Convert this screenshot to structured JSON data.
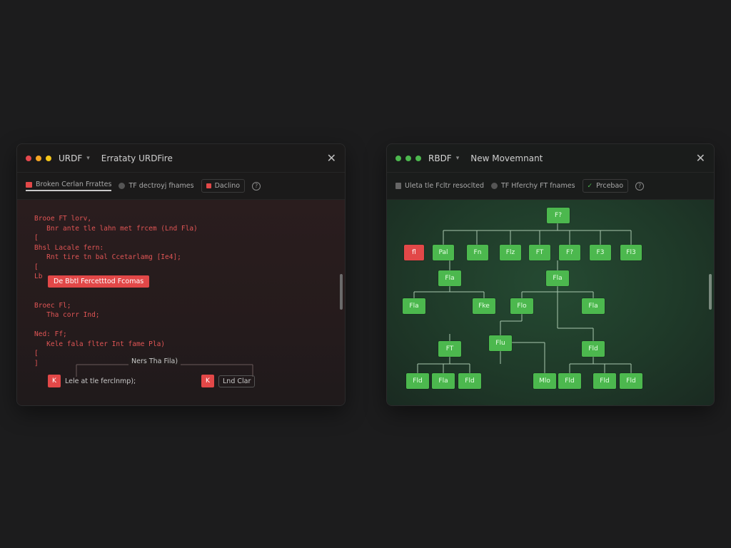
{
  "left_panel": {
    "app_name": "URDF",
    "doc_title": "Errataty URDFire",
    "dot_colors": [
      "#e5484d",
      "#f5a524",
      "#f5c518"
    ],
    "toolbar": {
      "item1": "Broken Cerlan Frrattes",
      "item2": "TF dectroyj fhames",
      "item3": "Daclino",
      "help": "?"
    },
    "code_lines": [
      "Brooe FT lorv,",
      "   Bnr ante tle lahn met frcem (Lnd Fla)",
      "[",
      "Bhsl Lacale fern:",
      "   Rnt tire tn bal Ccetarlamg [Ie4];",
      "[",
      "Lb",
      "",
      "",
      "Broec Fl;",
      "   Tha corr Ind;",
      "",
      "Ned: Ff;",
      "   Kele fala flter Int fame Pla)",
      "[",
      "]"
    ],
    "error_badge": "De Bbtl Fercetttod Fcomas",
    "bottom": {
      "center_label": "Ners Tha Fila)",
      "left_icon": "K",
      "left_label": "Lele at tle ferclnmp);",
      "right_icon": "K",
      "right_label": "Lnd Clar"
    }
  },
  "right_panel": {
    "app_name": "RBDF",
    "doc_title": "New Movemnant",
    "dot_colors": [
      "#4cb84e",
      "#4cb84e",
      "#4cb84e"
    ],
    "toolbar": {
      "item1": "Uleta tle Fcltr resoclted",
      "item2": "TF Hferchy FT fnames",
      "item3": "Prcebao",
      "help": "?"
    },
    "tree_nodes": [
      {
        "id": "root",
        "label": "F?",
        "color": "green"
      },
      {
        "id": "n1",
        "label": "fl",
        "color": "red"
      },
      {
        "id": "n2",
        "label": "Pal",
        "color": "green"
      },
      {
        "id": "n3",
        "label": "Fn",
        "color": "green"
      },
      {
        "id": "n4",
        "label": "Flz",
        "color": "green"
      },
      {
        "id": "n5",
        "label": "FT",
        "color": "green"
      },
      {
        "id": "n6",
        "label": "F?",
        "color": "green"
      },
      {
        "id": "n7",
        "label": "F3",
        "color": "green"
      },
      {
        "id": "n8",
        "label": "Fl3",
        "color": "green"
      },
      {
        "id": "m1",
        "label": "Fla",
        "color": "green"
      },
      {
        "id": "m2",
        "label": "Fla",
        "color": "green"
      },
      {
        "id": "l1",
        "label": "Fla",
        "color": "green"
      },
      {
        "id": "l2",
        "label": "Fke",
        "color": "green"
      },
      {
        "id": "l3",
        "label": "Flo",
        "color": "green"
      },
      {
        "id": "l4",
        "label": "Fla",
        "color": "green"
      },
      {
        "id": "k1",
        "label": "Flu",
        "color": "green"
      },
      {
        "id": "k2",
        "label": "FT",
        "color": "green"
      },
      {
        "id": "k3",
        "label": "Fld",
        "color": "green"
      },
      {
        "id": "b1",
        "label": "Fld",
        "color": "green"
      },
      {
        "id": "b2",
        "label": "Fla",
        "color": "green"
      },
      {
        "id": "b3",
        "label": "Fld",
        "color": "green"
      },
      {
        "id": "b4",
        "label": "Mlo",
        "color": "green"
      },
      {
        "id": "b5",
        "label": "Fld",
        "color": "green"
      },
      {
        "id": "b6",
        "label": "Fld",
        "color": "green"
      },
      {
        "id": "b7",
        "label": "Fld",
        "color": "green"
      }
    ]
  }
}
